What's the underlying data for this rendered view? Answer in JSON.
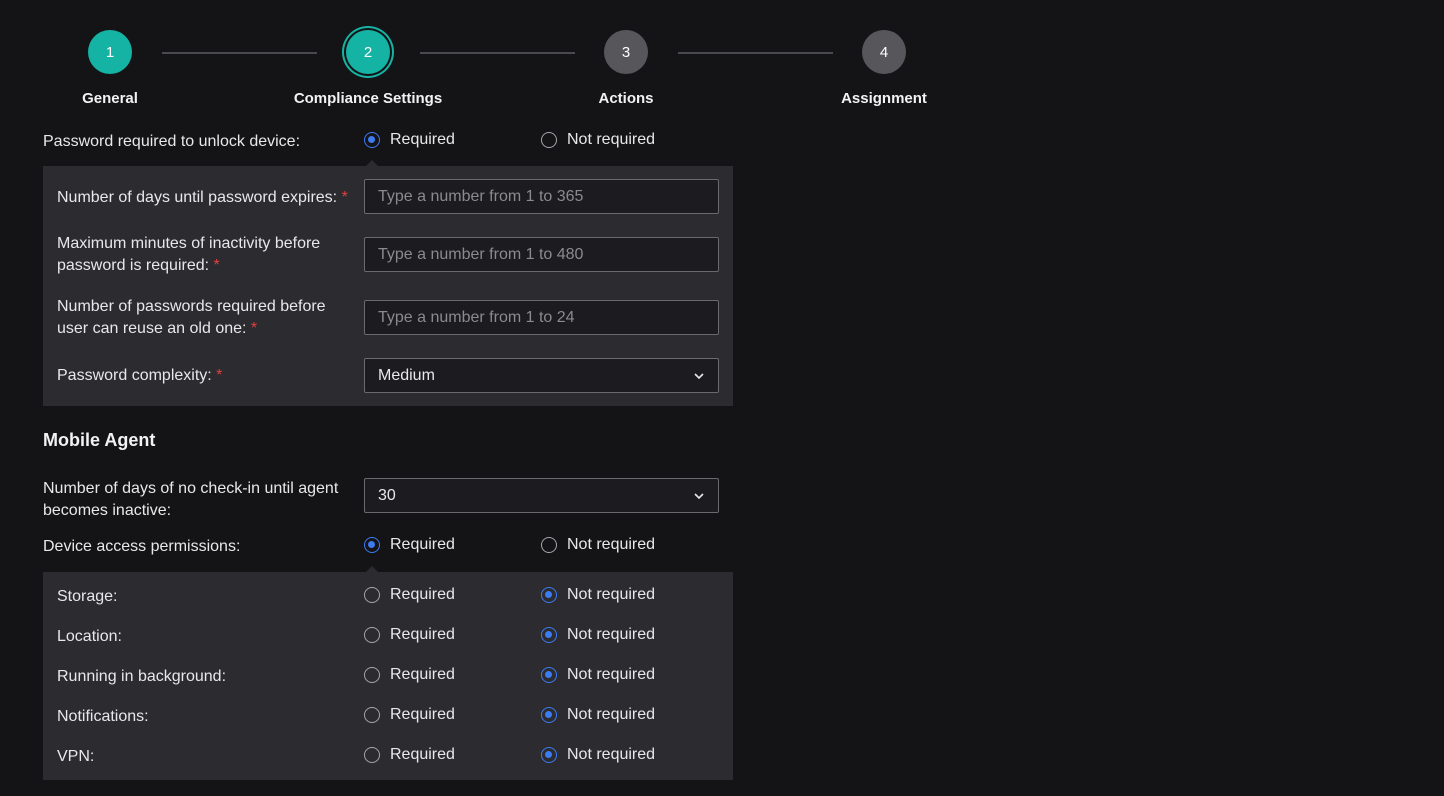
{
  "stepper": {
    "steps": [
      {
        "number": "1",
        "label": "General"
      },
      {
        "number": "2",
        "label": "Compliance Settings"
      },
      {
        "number": "3",
        "label": "Actions"
      },
      {
        "number": "4",
        "label": "Assignment"
      }
    ]
  },
  "password": {
    "label": "Password required to unlock device:",
    "required_label": "Required",
    "not_required_label": "Not required",
    "selected": "Required",
    "expires_label": "Number of days until password expires:",
    "expires_placeholder": "Type a number from 1 to 365",
    "inactivity_label_1": "Maximum minutes of inactivity before",
    "inactivity_label_2": "password is required:",
    "inactivity_placeholder": "Type a number from 1 to 480",
    "reuse_label_1": "Number of passwords required before",
    "reuse_label_2": "user can reuse an old one:",
    "reuse_placeholder": "Type a number from 1 to 24",
    "complexity_label": "Password complexity:",
    "complexity_value": "Medium",
    "asterisk": "*"
  },
  "mobile_agent": {
    "title": "Mobile Agent",
    "checkin_label_1": "Number of days of no check-in until agent",
    "checkin_label_2": "becomes inactive:",
    "checkin_value": "30",
    "permissions_label": "Device access permissions:",
    "permissions_selected": "Required",
    "required_label": "Required",
    "not_required_label": "Not required",
    "permissions": [
      {
        "label": "Storage:",
        "selected": "Not required"
      },
      {
        "label": "Location:",
        "selected": "Not required"
      },
      {
        "label": "Running in background:",
        "selected": "Not required"
      },
      {
        "label": "Notifications:",
        "selected": "Not required"
      },
      {
        "label": "VPN:",
        "selected": "Not required"
      }
    ]
  },
  "colors": {
    "accent_teal": "#14b3a3",
    "radio_blue": "#3d7bf0",
    "required_red": "#e0413f"
  }
}
